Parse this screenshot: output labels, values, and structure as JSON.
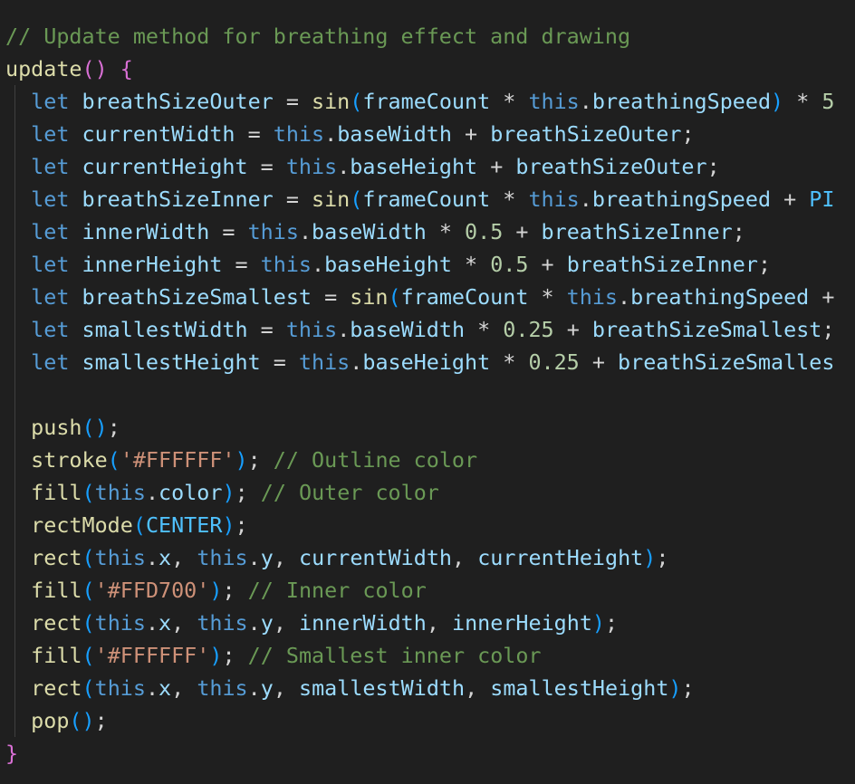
{
  "editor": {
    "theme": {
      "background": "#1f1f1f",
      "comment": "#6a9955",
      "keyword": "#569cd6",
      "function": "#dcdcaa",
      "variable": "#9cdcfe",
      "string": "#ce9178",
      "number": "#b5cea8",
      "constant": "#4fc1ff",
      "plain": "#d4d4d4",
      "bracket_level1": "#da70d6",
      "bracket_level2": "#179fff"
    },
    "lines": [
      [
        {
          "t": "comment",
          "v": "// Update method for breathing effect and drawing"
        }
      ],
      [
        {
          "t": "function",
          "v": "update"
        },
        {
          "t": "bracket1",
          "v": "()"
        },
        {
          "t": "plain",
          "v": " "
        },
        {
          "t": "bracket1",
          "v": "{"
        }
      ],
      [
        {
          "t": "plain",
          "v": "  "
        },
        {
          "t": "keyword",
          "v": "let"
        },
        {
          "t": "plain",
          "v": " "
        },
        {
          "t": "variable",
          "v": "breathSizeOuter"
        },
        {
          "t": "plain",
          "v": " = "
        },
        {
          "t": "function",
          "v": "sin"
        },
        {
          "t": "bracket2",
          "v": "("
        },
        {
          "t": "variable",
          "v": "frameCount"
        },
        {
          "t": "plain",
          "v": " * "
        },
        {
          "t": "keyword",
          "v": "this"
        },
        {
          "t": "plain",
          "v": "."
        },
        {
          "t": "variable",
          "v": "breathingSpeed"
        },
        {
          "t": "bracket2",
          "v": ")"
        },
        {
          "t": "plain",
          "v": " * "
        },
        {
          "t": "number",
          "v": "5"
        }
      ],
      [
        {
          "t": "plain",
          "v": "  "
        },
        {
          "t": "keyword",
          "v": "let"
        },
        {
          "t": "plain",
          "v": " "
        },
        {
          "t": "variable",
          "v": "currentWidth"
        },
        {
          "t": "plain",
          "v": " = "
        },
        {
          "t": "keyword",
          "v": "this"
        },
        {
          "t": "plain",
          "v": "."
        },
        {
          "t": "variable",
          "v": "baseWidth"
        },
        {
          "t": "plain",
          "v": " + "
        },
        {
          "t": "variable",
          "v": "breathSizeOuter"
        },
        {
          "t": "plain",
          "v": ";"
        }
      ],
      [
        {
          "t": "plain",
          "v": "  "
        },
        {
          "t": "keyword",
          "v": "let"
        },
        {
          "t": "plain",
          "v": " "
        },
        {
          "t": "variable",
          "v": "currentHeight"
        },
        {
          "t": "plain",
          "v": " = "
        },
        {
          "t": "keyword",
          "v": "this"
        },
        {
          "t": "plain",
          "v": "."
        },
        {
          "t": "variable",
          "v": "baseHeight"
        },
        {
          "t": "plain",
          "v": " + "
        },
        {
          "t": "variable",
          "v": "breathSizeOuter"
        },
        {
          "t": "plain",
          "v": ";"
        }
      ],
      [
        {
          "t": "plain",
          "v": "  "
        },
        {
          "t": "keyword",
          "v": "let"
        },
        {
          "t": "plain",
          "v": " "
        },
        {
          "t": "variable",
          "v": "breathSizeInner"
        },
        {
          "t": "plain",
          "v": " = "
        },
        {
          "t": "function",
          "v": "sin"
        },
        {
          "t": "bracket2",
          "v": "("
        },
        {
          "t": "variable",
          "v": "frameCount"
        },
        {
          "t": "plain",
          "v": " * "
        },
        {
          "t": "keyword",
          "v": "this"
        },
        {
          "t": "plain",
          "v": "."
        },
        {
          "t": "variable",
          "v": "breathingSpeed"
        },
        {
          "t": "plain",
          "v": " + "
        },
        {
          "t": "constant",
          "v": "PI"
        }
      ],
      [
        {
          "t": "plain",
          "v": "  "
        },
        {
          "t": "keyword",
          "v": "let"
        },
        {
          "t": "plain",
          "v": " "
        },
        {
          "t": "variable",
          "v": "innerWidth"
        },
        {
          "t": "plain",
          "v": " = "
        },
        {
          "t": "keyword",
          "v": "this"
        },
        {
          "t": "plain",
          "v": "."
        },
        {
          "t": "variable",
          "v": "baseWidth"
        },
        {
          "t": "plain",
          "v": " * "
        },
        {
          "t": "number",
          "v": "0.5"
        },
        {
          "t": "plain",
          "v": " + "
        },
        {
          "t": "variable",
          "v": "breathSizeInner"
        },
        {
          "t": "plain",
          "v": ";"
        }
      ],
      [
        {
          "t": "plain",
          "v": "  "
        },
        {
          "t": "keyword",
          "v": "let"
        },
        {
          "t": "plain",
          "v": " "
        },
        {
          "t": "variable",
          "v": "innerHeight"
        },
        {
          "t": "plain",
          "v": " = "
        },
        {
          "t": "keyword",
          "v": "this"
        },
        {
          "t": "plain",
          "v": "."
        },
        {
          "t": "variable",
          "v": "baseHeight"
        },
        {
          "t": "plain",
          "v": " * "
        },
        {
          "t": "number",
          "v": "0.5"
        },
        {
          "t": "plain",
          "v": " + "
        },
        {
          "t": "variable",
          "v": "breathSizeInner"
        },
        {
          "t": "plain",
          "v": ";"
        }
      ],
      [
        {
          "t": "plain",
          "v": "  "
        },
        {
          "t": "keyword",
          "v": "let"
        },
        {
          "t": "plain",
          "v": " "
        },
        {
          "t": "variable",
          "v": "breathSizeSmallest"
        },
        {
          "t": "plain",
          "v": " = "
        },
        {
          "t": "function",
          "v": "sin"
        },
        {
          "t": "bracket2",
          "v": "("
        },
        {
          "t": "variable",
          "v": "frameCount"
        },
        {
          "t": "plain",
          "v": " * "
        },
        {
          "t": "keyword",
          "v": "this"
        },
        {
          "t": "plain",
          "v": "."
        },
        {
          "t": "variable",
          "v": "breathingSpeed"
        },
        {
          "t": "plain",
          "v": " +"
        }
      ],
      [
        {
          "t": "plain",
          "v": "  "
        },
        {
          "t": "keyword",
          "v": "let"
        },
        {
          "t": "plain",
          "v": " "
        },
        {
          "t": "variable",
          "v": "smallestWidth"
        },
        {
          "t": "plain",
          "v": " = "
        },
        {
          "t": "keyword",
          "v": "this"
        },
        {
          "t": "plain",
          "v": "."
        },
        {
          "t": "variable",
          "v": "baseWidth"
        },
        {
          "t": "plain",
          "v": " * "
        },
        {
          "t": "number",
          "v": "0.25"
        },
        {
          "t": "plain",
          "v": " + "
        },
        {
          "t": "variable",
          "v": "breathSizeSmallest"
        },
        {
          "t": "plain",
          "v": ";"
        }
      ],
      [
        {
          "t": "plain",
          "v": "  "
        },
        {
          "t": "keyword",
          "v": "let"
        },
        {
          "t": "plain",
          "v": " "
        },
        {
          "t": "variable",
          "v": "smallestHeight"
        },
        {
          "t": "plain",
          "v": " = "
        },
        {
          "t": "keyword",
          "v": "this"
        },
        {
          "t": "plain",
          "v": "."
        },
        {
          "t": "variable",
          "v": "baseHeight"
        },
        {
          "t": "plain",
          "v": " * "
        },
        {
          "t": "number",
          "v": "0.25"
        },
        {
          "t": "plain",
          "v": " + "
        },
        {
          "t": "variable",
          "v": "breathSizeSmalles"
        }
      ],
      [],
      [
        {
          "t": "plain",
          "v": "  "
        },
        {
          "t": "function",
          "v": "push"
        },
        {
          "t": "bracket2",
          "v": "()"
        },
        {
          "t": "plain",
          "v": ";"
        }
      ],
      [
        {
          "t": "plain",
          "v": "  "
        },
        {
          "t": "function",
          "v": "stroke"
        },
        {
          "t": "bracket2",
          "v": "("
        },
        {
          "t": "string",
          "v": "'#FFFFFF'"
        },
        {
          "t": "bracket2",
          "v": ")"
        },
        {
          "t": "plain",
          "v": "; "
        },
        {
          "t": "comment",
          "v": "// Outline color"
        }
      ],
      [
        {
          "t": "plain",
          "v": "  "
        },
        {
          "t": "function",
          "v": "fill"
        },
        {
          "t": "bracket2",
          "v": "("
        },
        {
          "t": "keyword",
          "v": "this"
        },
        {
          "t": "plain",
          "v": "."
        },
        {
          "t": "variable",
          "v": "color"
        },
        {
          "t": "bracket2",
          "v": ")"
        },
        {
          "t": "plain",
          "v": "; "
        },
        {
          "t": "comment",
          "v": "// Outer color"
        }
      ],
      [
        {
          "t": "plain",
          "v": "  "
        },
        {
          "t": "function",
          "v": "rectMode"
        },
        {
          "t": "bracket2",
          "v": "("
        },
        {
          "t": "constant",
          "v": "CENTER"
        },
        {
          "t": "bracket2",
          "v": ")"
        },
        {
          "t": "plain",
          "v": ";"
        }
      ],
      [
        {
          "t": "plain",
          "v": "  "
        },
        {
          "t": "function",
          "v": "rect"
        },
        {
          "t": "bracket2",
          "v": "("
        },
        {
          "t": "keyword",
          "v": "this"
        },
        {
          "t": "plain",
          "v": "."
        },
        {
          "t": "variable",
          "v": "x"
        },
        {
          "t": "plain",
          "v": ", "
        },
        {
          "t": "keyword",
          "v": "this"
        },
        {
          "t": "plain",
          "v": "."
        },
        {
          "t": "variable",
          "v": "y"
        },
        {
          "t": "plain",
          "v": ", "
        },
        {
          "t": "variable",
          "v": "currentWidth"
        },
        {
          "t": "plain",
          "v": ", "
        },
        {
          "t": "variable",
          "v": "currentHeight"
        },
        {
          "t": "bracket2",
          "v": ")"
        },
        {
          "t": "plain",
          "v": ";"
        }
      ],
      [
        {
          "t": "plain",
          "v": "  "
        },
        {
          "t": "function",
          "v": "fill"
        },
        {
          "t": "bracket2",
          "v": "("
        },
        {
          "t": "string",
          "v": "'#FFD700'"
        },
        {
          "t": "bracket2",
          "v": ")"
        },
        {
          "t": "plain",
          "v": "; "
        },
        {
          "t": "comment",
          "v": "// Inner color"
        }
      ],
      [
        {
          "t": "plain",
          "v": "  "
        },
        {
          "t": "function",
          "v": "rect"
        },
        {
          "t": "bracket2",
          "v": "("
        },
        {
          "t": "keyword",
          "v": "this"
        },
        {
          "t": "plain",
          "v": "."
        },
        {
          "t": "variable",
          "v": "x"
        },
        {
          "t": "plain",
          "v": ", "
        },
        {
          "t": "keyword",
          "v": "this"
        },
        {
          "t": "plain",
          "v": "."
        },
        {
          "t": "variable",
          "v": "y"
        },
        {
          "t": "plain",
          "v": ", "
        },
        {
          "t": "variable",
          "v": "innerWidth"
        },
        {
          "t": "plain",
          "v": ", "
        },
        {
          "t": "variable",
          "v": "innerHeight"
        },
        {
          "t": "bracket2",
          "v": ")"
        },
        {
          "t": "plain",
          "v": ";"
        }
      ],
      [
        {
          "t": "plain",
          "v": "  "
        },
        {
          "t": "function",
          "v": "fill"
        },
        {
          "t": "bracket2",
          "v": "("
        },
        {
          "t": "string",
          "v": "'#FFFFFF'"
        },
        {
          "t": "bracket2",
          "v": ")"
        },
        {
          "t": "plain",
          "v": "; "
        },
        {
          "t": "comment",
          "v": "// Smallest inner color"
        }
      ],
      [
        {
          "t": "plain",
          "v": "  "
        },
        {
          "t": "function",
          "v": "rect"
        },
        {
          "t": "bracket2",
          "v": "("
        },
        {
          "t": "keyword",
          "v": "this"
        },
        {
          "t": "plain",
          "v": "."
        },
        {
          "t": "variable",
          "v": "x"
        },
        {
          "t": "plain",
          "v": ", "
        },
        {
          "t": "keyword",
          "v": "this"
        },
        {
          "t": "plain",
          "v": "."
        },
        {
          "t": "variable",
          "v": "y"
        },
        {
          "t": "plain",
          "v": ", "
        },
        {
          "t": "variable",
          "v": "smallestWidth"
        },
        {
          "t": "plain",
          "v": ", "
        },
        {
          "t": "variable",
          "v": "smallestHeight"
        },
        {
          "t": "bracket2",
          "v": ")"
        },
        {
          "t": "plain",
          "v": ";"
        }
      ],
      [
        {
          "t": "plain",
          "v": "  "
        },
        {
          "t": "function",
          "v": "pop"
        },
        {
          "t": "bracket2",
          "v": "()"
        },
        {
          "t": "plain",
          "v": ";"
        }
      ],
      [
        {
          "t": "bracket1",
          "v": "}"
        }
      ]
    ]
  }
}
